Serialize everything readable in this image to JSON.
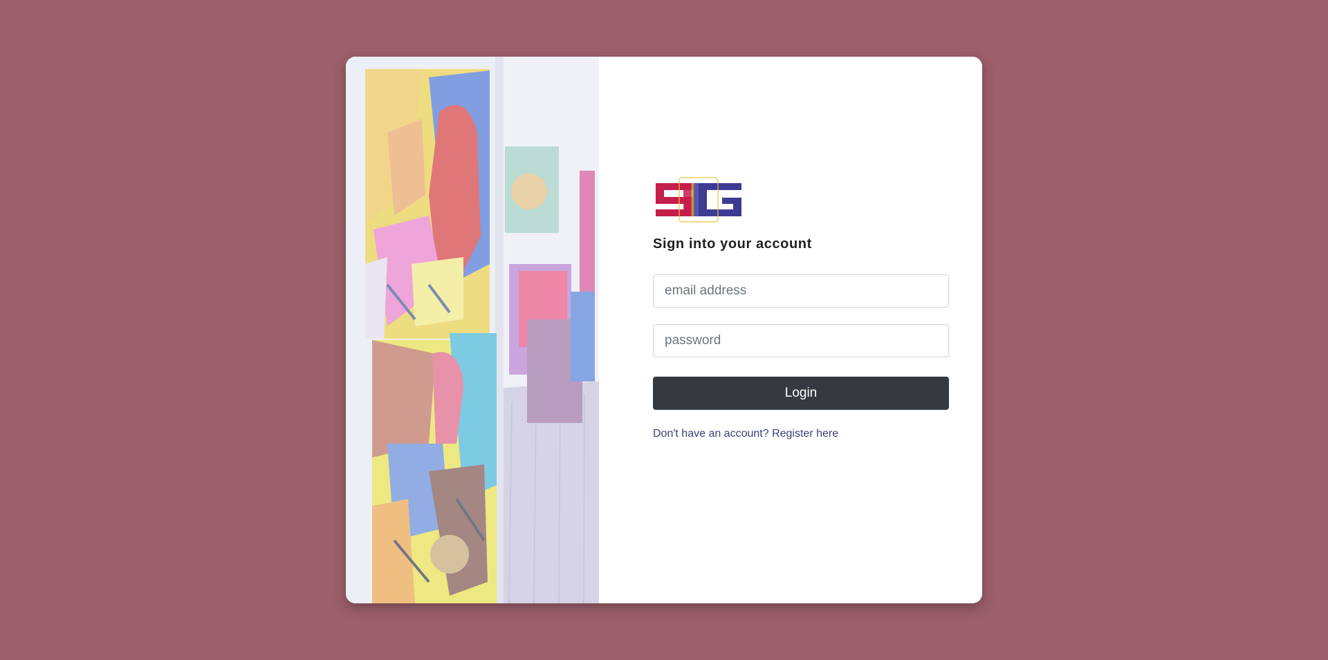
{
  "page": {
    "background_color": "#9c5f6b"
  },
  "logo": {
    "text": "SG",
    "colors": [
      "#c41e4a",
      "#f5c518",
      "#3d3a94"
    ],
    "icon": "sg-logo-icon"
  },
  "art_image": {
    "icon": "art-gallery-photo",
    "description_visible": false
  },
  "form": {
    "heading": "Sign into your account",
    "email_placeholder": "email address",
    "password_placeholder": "password",
    "login_label": "Login",
    "register_prompt": "Don't have an account?",
    "register_link": "Register here"
  },
  "colors": {
    "button": "#343a40",
    "link": "#3b3f7a"
  }
}
